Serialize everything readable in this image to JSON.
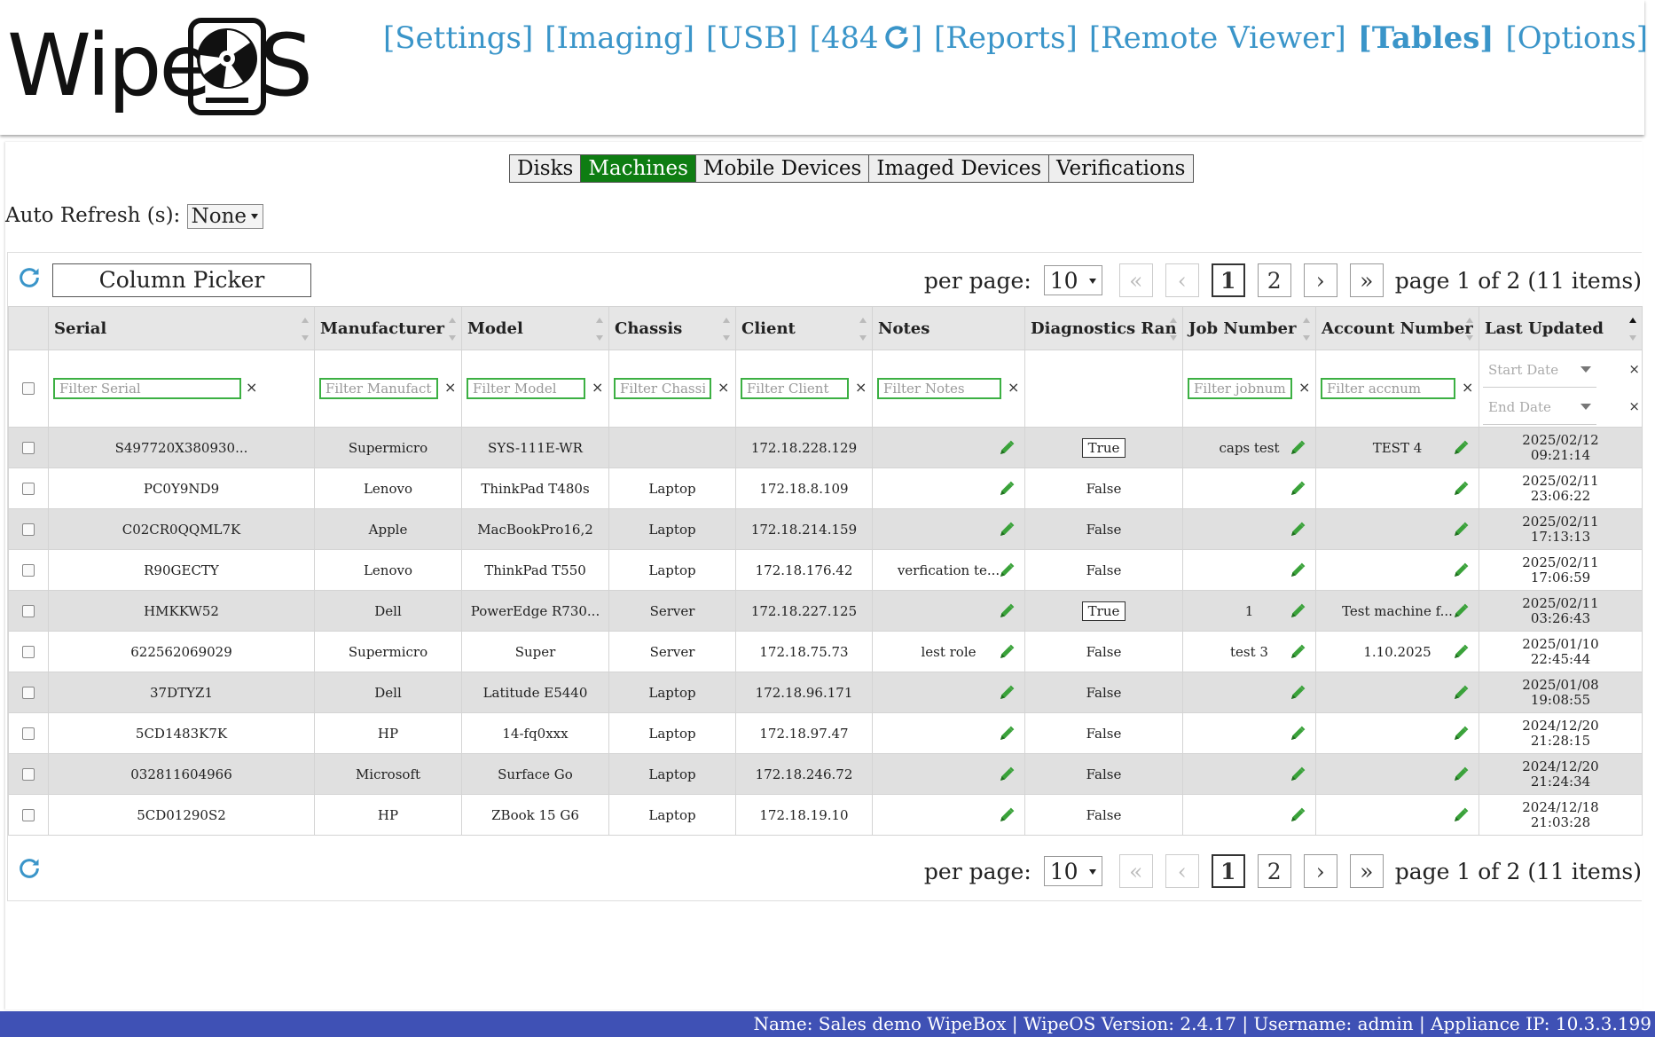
{
  "brand": {
    "logo_prefix": "Wipe",
    "logo_suffix": "S",
    "logo_alt": "WipeOS"
  },
  "nav": {
    "settings": "[Settings]",
    "imaging": "[Imaging]",
    "usb": "[USB]",
    "count_open": "[484",
    "count_close": "]",
    "reports": "[Reports]",
    "remote_viewer": "[Remote Viewer]",
    "tables": "[Tables]",
    "options": "[Options]"
  },
  "tabs": [
    {
      "label": "Disks",
      "active": false
    },
    {
      "label": "Machines",
      "active": true
    },
    {
      "label": "Mobile Devices",
      "active": false
    },
    {
      "label": "Imaged Devices",
      "active": false
    },
    {
      "label": "Verifications",
      "active": false
    }
  ],
  "auto_refresh": {
    "label": "Auto Refresh (s):",
    "value": "None"
  },
  "toolbar": {
    "column_picker": "Column Picker",
    "per_page_label": "per page:",
    "per_page_value": "10",
    "first": "«",
    "prev": "‹",
    "page1": "1",
    "page2": "2",
    "next": "›",
    "last": "»",
    "page_info": "page 1 of 2 (11 items)"
  },
  "columns": {
    "serial": "Serial",
    "manufacturer": "Manufacturer",
    "model": "Model",
    "chassis": "Chassis",
    "client": "Client",
    "notes": "Notes",
    "diagnostics": "Diagnostics Ran",
    "job": "Job Number",
    "account": "Account Number",
    "updated": "Last Updated"
  },
  "filters": {
    "serial": "Filter Serial",
    "manufacturer": "Filter Manufacturer",
    "model": "Filter Model",
    "chassis": "Filter Chassis",
    "client": "Filter Client",
    "notes": "Filter Notes",
    "job": "Filter jobnum",
    "account": "Filter accnum",
    "start_date": "Start Date",
    "end_date": "End Date",
    "clear": "×"
  },
  "rows": [
    {
      "serial": "S497720X380930...",
      "manufacturer": "Supermicro",
      "model": "SYS-111E-WR",
      "chassis": "",
      "client": "172.18.228.129",
      "notes": "",
      "diagnostics": "True",
      "diag_button": true,
      "job": "caps test",
      "account": "TEST 4",
      "date": "2025/02/12",
      "time": "09:21:14"
    },
    {
      "serial": "PC0Y9ND9",
      "manufacturer": "Lenovo",
      "model": "ThinkPad T480s",
      "chassis": "Laptop",
      "client": "172.18.8.109",
      "notes": "",
      "diagnostics": "False",
      "diag_button": false,
      "job": "",
      "account": "",
      "date": "2025/02/11",
      "time": "23:06:22"
    },
    {
      "serial": "C02CR0QQML7K",
      "manufacturer": "Apple",
      "model": "MacBookPro16,2",
      "chassis": "Laptop",
      "client": "172.18.214.159",
      "notes": "",
      "diagnostics": "False",
      "diag_button": false,
      "job": "",
      "account": "",
      "date": "2025/02/11",
      "time": "17:13:13"
    },
    {
      "serial": "R90GECTY",
      "manufacturer": "Lenovo",
      "model": "ThinkPad T550",
      "chassis": "Laptop",
      "client": "172.18.176.42",
      "notes": "verfication te...",
      "diagnostics": "False",
      "diag_button": false,
      "job": "",
      "account": "",
      "date": "2025/02/11",
      "time": "17:06:59"
    },
    {
      "serial": "HMKKW52",
      "manufacturer": "Dell",
      "model": "PowerEdge R730...",
      "chassis": "Server",
      "client": "172.18.227.125",
      "notes": "",
      "diagnostics": "True",
      "diag_button": true,
      "job": "1",
      "account": "Test machine f...",
      "date": "2025/02/11",
      "time": "03:26:43"
    },
    {
      "serial": "622562069029",
      "manufacturer": "Supermicro",
      "model": "Super",
      "chassis": "Server",
      "client": "172.18.75.73",
      "notes": "lest role",
      "diagnostics": "False",
      "diag_button": false,
      "job": "test 3",
      "account": "1.10.2025",
      "date": "2025/01/10",
      "time": "22:45:44"
    },
    {
      "serial": "37DTYZ1",
      "manufacturer": "Dell",
      "model": "Latitude E5440",
      "chassis": "Laptop",
      "client": "172.18.96.171",
      "notes": "",
      "diagnostics": "False",
      "diag_button": false,
      "job": "",
      "account": "",
      "date": "2025/01/08",
      "time": "19:08:55"
    },
    {
      "serial": "5CD1483K7K",
      "manufacturer": "HP",
      "model": "14-fq0xxx",
      "chassis": "Laptop",
      "client": "172.18.97.47",
      "notes": "",
      "diagnostics": "False",
      "diag_button": false,
      "job": "",
      "account": "",
      "date": "2024/12/20",
      "time": "21:28:15"
    },
    {
      "serial": "032811604966",
      "manufacturer": "Microsoft",
      "model": "Surface Go",
      "chassis": "Laptop",
      "client": "172.18.246.72",
      "notes": "",
      "diagnostics": "False",
      "diag_button": false,
      "job": "",
      "account": "",
      "date": "2024/12/20",
      "time": "21:24:34"
    },
    {
      "serial": "5CD01290S2",
      "manufacturer": "HP",
      "model": "ZBook 15 G6",
      "chassis": "Laptop",
      "client": "172.18.19.10",
      "notes": "",
      "diagnostics": "False",
      "diag_button": false,
      "job": "",
      "account": "",
      "date": "2024/12/18",
      "time": "21:03:28"
    }
  ],
  "footer": {
    "text": "Name: Sales demo WipeBox | WipeOS Version: 2.4.17 | Username: admin | Appliance IP: 10.3.3.199"
  },
  "colors": {
    "accent": "#3a95c9",
    "active_tab": "#0e7d12",
    "footer": "#3f51b5",
    "filter_border": "#3cb043",
    "pencil": "#3aa23a"
  }
}
